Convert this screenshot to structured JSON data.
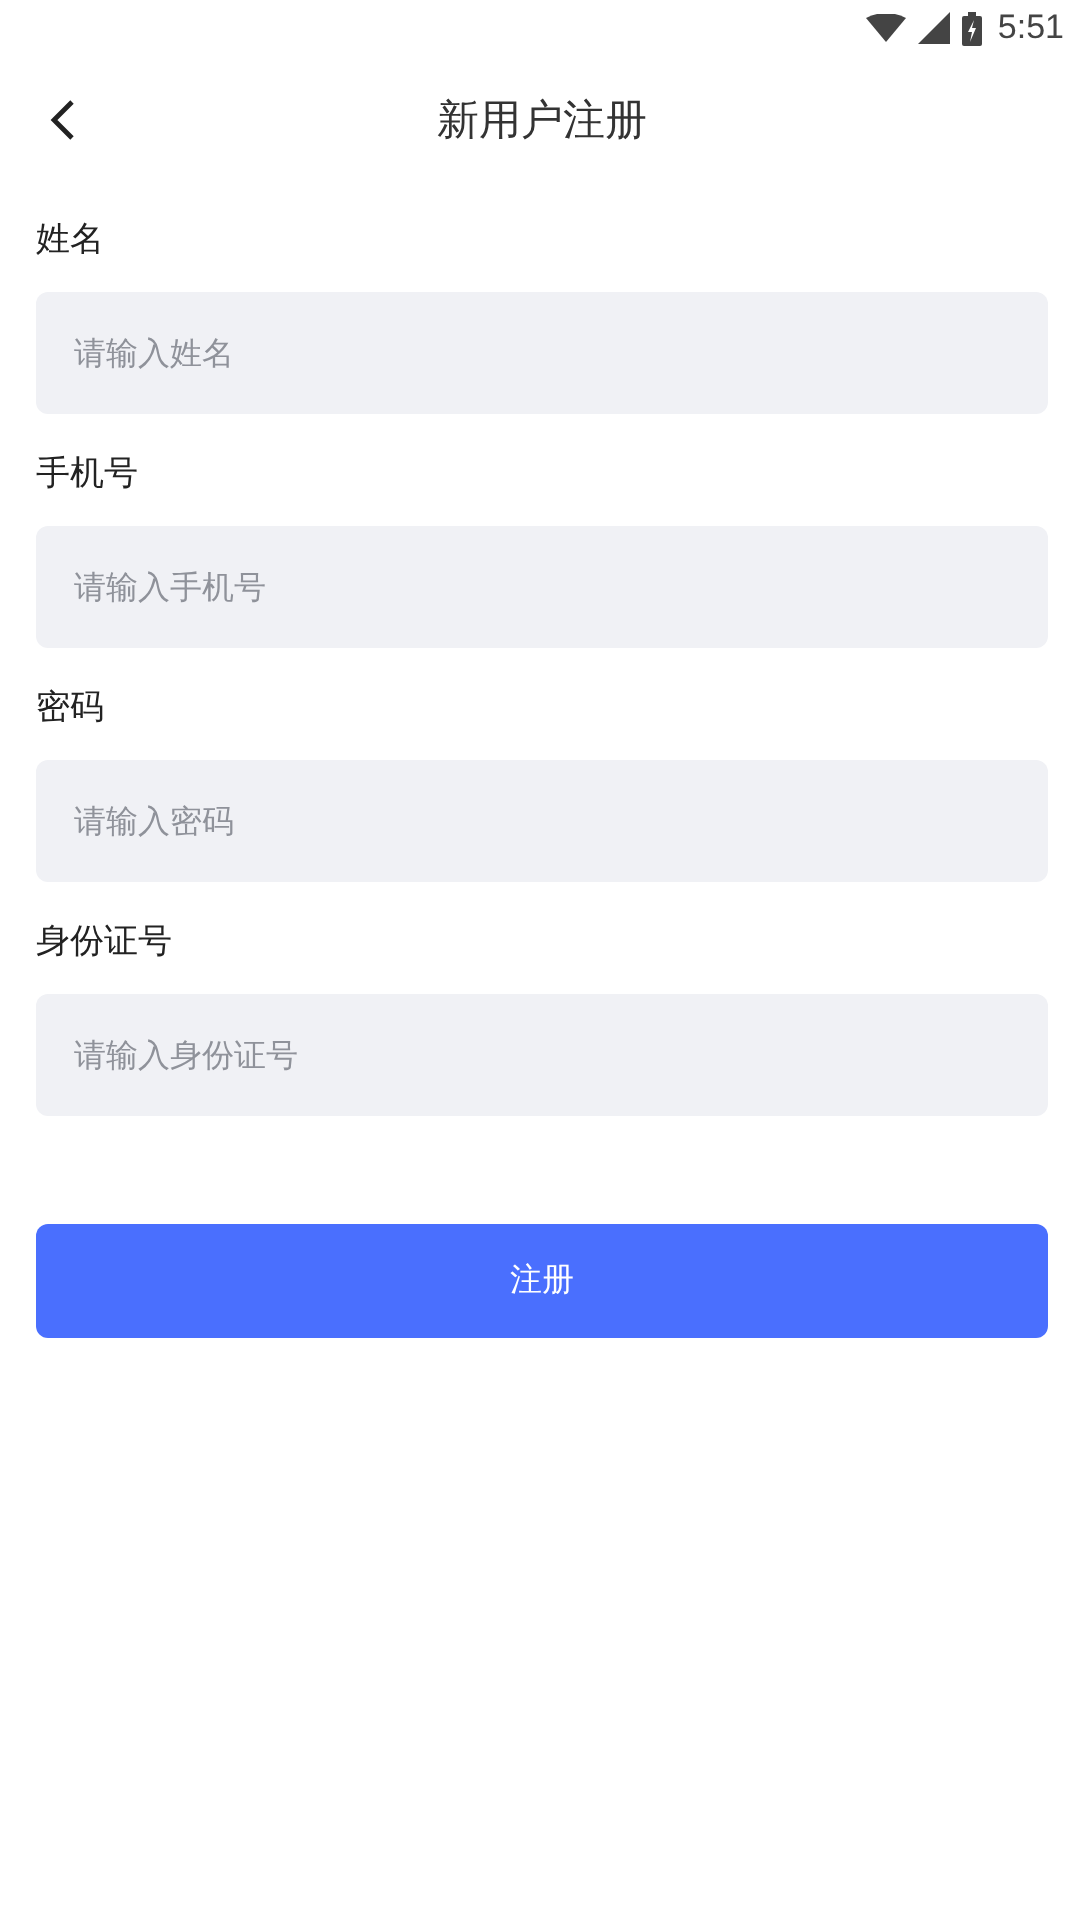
{
  "status_bar": {
    "time": "5:51"
  },
  "header": {
    "title": "新用户注册"
  },
  "fields": [
    {
      "label": "姓名",
      "placeholder": "请输入姓名"
    },
    {
      "label": "手机号",
      "placeholder": "请输入手机号"
    },
    {
      "label": "密码",
      "placeholder": "请输入密码"
    },
    {
      "label": "身份证号",
      "placeholder": "请输入身份证号"
    }
  ],
  "submit_button": {
    "label": "注册"
  }
}
